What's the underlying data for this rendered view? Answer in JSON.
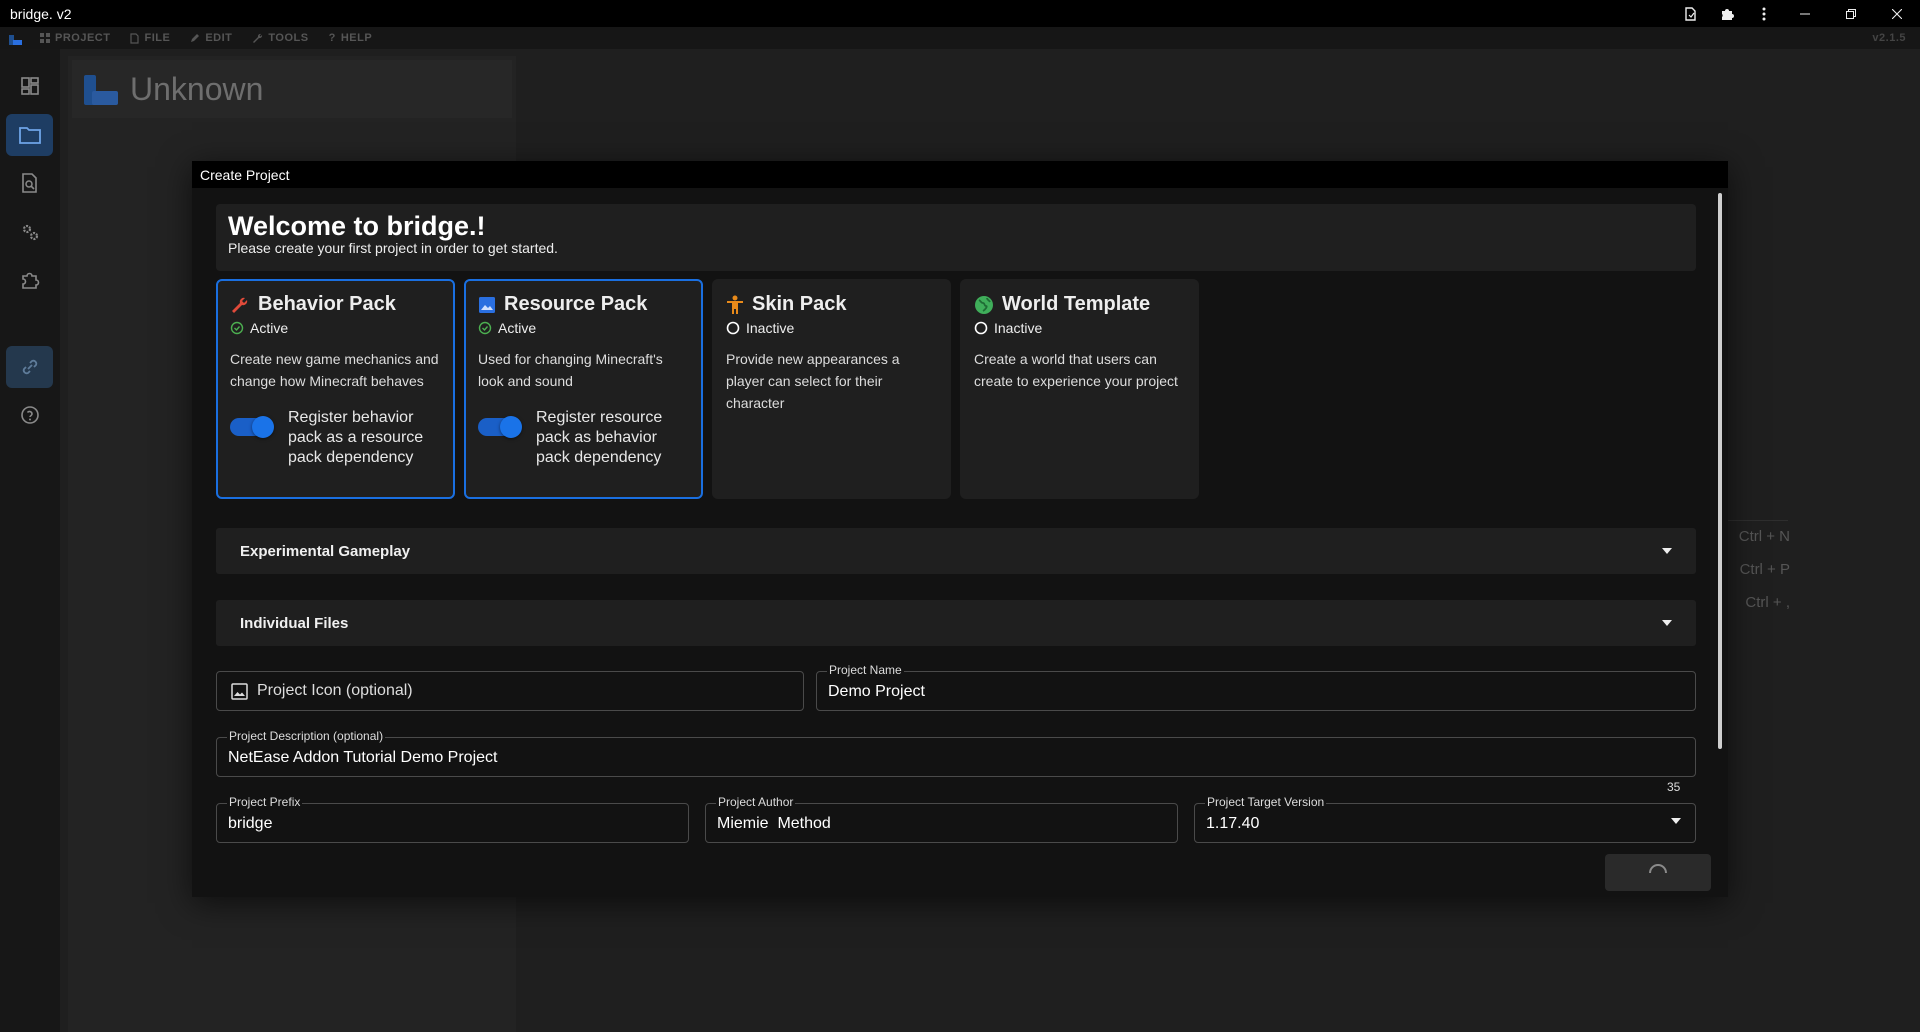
{
  "window": {
    "title": "bridge. v2"
  },
  "menubar": {
    "items": [
      {
        "label": "PROJECT",
        "icon": "grid-icon"
      },
      {
        "label": "FILE",
        "icon": "file-icon"
      },
      {
        "label": "EDIT",
        "icon": "pencil-icon"
      },
      {
        "label": "TOOLS",
        "icon": "wrench-icon"
      },
      {
        "label": "HELP",
        "icon": "question-icon"
      }
    ],
    "version": "v2.1.5"
  },
  "background": {
    "project_name": "Unknown",
    "shortcuts": [
      "Ctrl + N",
      "Ctrl + P",
      "Ctrl + ,"
    ]
  },
  "dialog": {
    "title": "Create Project",
    "welcome_title": "Welcome to bridge.!",
    "welcome_subtitle": "Please create your first project in order to get started.",
    "packs": [
      {
        "name": "Behavior Pack",
        "status": "Active",
        "description": "Create new game mechanics and change how Minecraft behaves",
        "toggle_label": "Register behavior pack as a resource pack dependency",
        "selected": true
      },
      {
        "name": "Resource Pack",
        "status": "Active",
        "description": "Used for changing Minecraft's look and sound",
        "toggle_label": "Register resource pack as behavior pack dependency",
        "selected": true
      },
      {
        "name": "Skin Pack",
        "status": "Inactive",
        "description": "Provide new appearances a player can select for their character",
        "selected": false
      },
      {
        "name": "World Template",
        "status": "Inactive",
        "description": "Create a world that users can create to experience your project",
        "selected": false
      }
    ],
    "accordions": [
      "Experimental Gameplay",
      "Individual Files"
    ],
    "fields": {
      "icon_placeholder": "Project Icon (optional)",
      "name_label": "Project Name",
      "name_value": "Demo Project",
      "description_label": "Project Description (optional)",
      "description_value": "NetEase Addon Tutorial Demo Project",
      "description_counter": "35",
      "prefix_label": "Project Prefix",
      "prefix_value": "bridge",
      "author_label": "Project Author",
      "author_value": "Miemie  Method",
      "version_label": "Project Target Version",
      "version_value": "1.17.40"
    }
  },
  "colors": {
    "accent": "#1a6fe0",
    "behavior_icon": "#e04a3a",
    "resource_icon": "#2a6fe0",
    "skin_icon": "#e88a1a",
    "world_icon": "#3fae5a",
    "active_check": "#4caf50"
  }
}
